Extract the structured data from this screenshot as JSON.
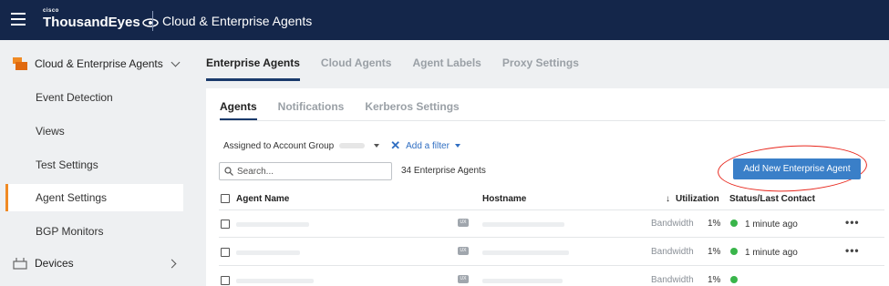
{
  "header": {
    "brand_top": "cisco",
    "brand": "ThousandEyes",
    "title": "Cloud & Enterprise Agents"
  },
  "sidebar": {
    "section_label": "Cloud & Enterprise Agents",
    "items": [
      {
        "label": "Event Detection"
      },
      {
        "label": "Views"
      },
      {
        "label": "Test Settings"
      },
      {
        "label": "Agent Settings",
        "active": true
      },
      {
        "label": "BGP Monitors"
      }
    ],
    "devices_label": "Devices"
  },
  "top_tabs": [
    {
      "label": "Enterprise Agents",
      "active": true
    },
    {
      "label": "Cloud Agents"
    },
    {
      "label": "Agent Labels"
    },
    {
      "label": "Proxy Settings"
    }
  ],
  "sub_tabs": [
    {
      "label": "Agents",
      "active": true
    },
    {
      "label": "Notifications"
    },
    {
      "label": "Kerberos Settings"
    }
  ],
  "filter": {
    "assigned_label": "Assigned to Account Group",
    "add_filter_label": "Add a filter"
  },
  "search": {
    "placeholder": "Search..."
  },
  "agent_count": "34 Enterprise Agents",
  "add_button_label": "Add New Enterprise Agent",
  "table": {
    "headers": {
      "name": "Agent Name",
      "hostname": "Hostname",
      "utilization": "Utilization",
      "status": "Status/Last Contact"
    },
    "rows": [
      {
        "utilization_type": "Bandwidth",
        "utilization_value": "1%",
        "status": "1 minute ago"
      },
      {
        "utilization_type": "Bandwidth",
        "utilization_value": "1%",
        "status": "1 minute ago"
      },
      {
        "utilization_type": "Bandwidth",
        "utilization_value": "1%",
        "status": ""
      }
    ]
  },
  "colors": {
    "topbar": "#14264a",
    "accent": "#f08a24",
    "button": "#3a7fc8",
    "status_online": "#39b54a",
    "annotation": "#e8281e"
  }
}
